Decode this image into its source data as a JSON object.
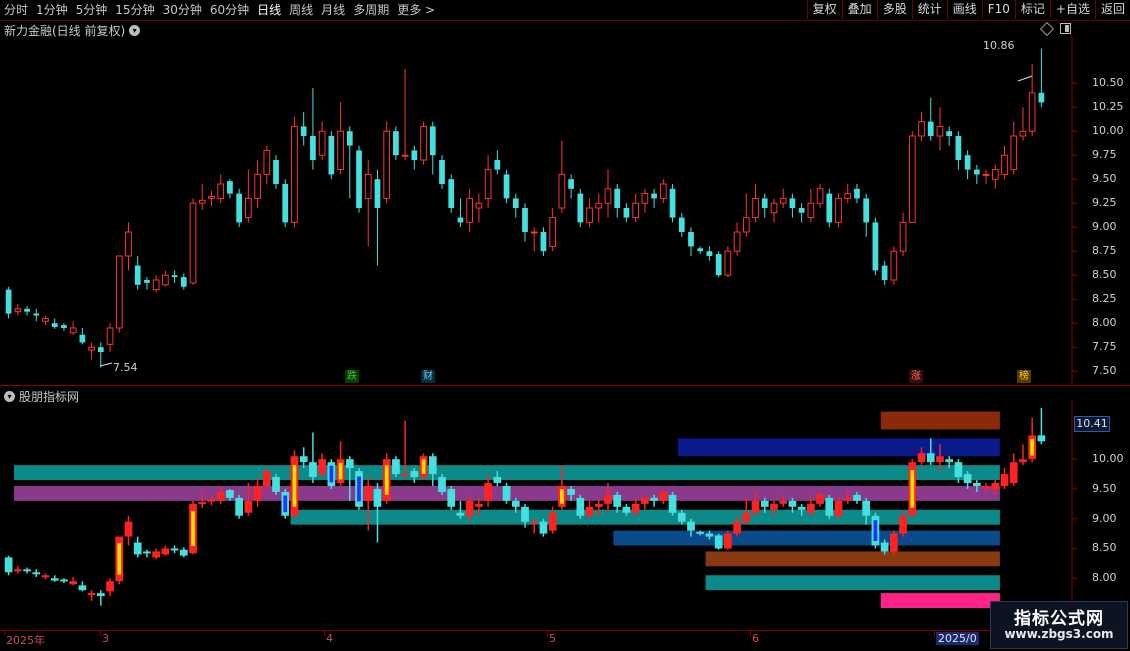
{
  "toolbar": {
    "periods": [
      "分时",
      "1分钟",
      "5分钟",
      "15分钟",
      "30分钟",
      "60分钟",
      "日线",
      "周线",
      "月线",
      "多周期",
      "更多 >"
    ],
    "active_period": "日线",
    "right_buttons": [
      "复权",
      "叠加",
      "多股",
      "统计",
      "画线",
      "F10",
      "标记",
      "+自选",
      "返回"
    ]
  },
  "main_panel": {
    "title": "新力金融(日线 前复权)",
    "high_mark": "10.86",
    "low_mark": "7.54",
    "y_ticks": [
      "10.50",
      "10.25",
      "10.00",
      "9.75",
      "9.50",
      "9.25",
      "9.00",
      "8.75",
      "8.50",
      "8.25",
      "8.00",
      "7.75",
      "7.50"
    ],
    "tags": [
      {
        "text": "跌",
        "color": "#33cc33",
        "bg": "#0a3a0a"
      },
      {
        "text": "财",
        "color": "#66ccff",
        "bg": "#0a2a3a"
      },
      {
        "text": "涨",
        "color": "#ff6666",
        "bg": "#3a0a0a"
      },
      {
        "text": "榜",
        "color": "#ffcc00",
        "bg": "#5a3a00"
      }
    ]
  },
  "indicator_panel": {
    "title": "股朋指标网",
    "y_ticks": [
      "10.00",
      "9.50",
      "9.00",
      "8.50",
      "8.00"
    ],
    "last_value": "10.41"
  },
  "date_axis": [
    "2025年",
    "3",
    "4",
    "5",
    "6",
    "2025/0"
  ],
  "watermark": {
    "line1": "指标公式网",
    "line2": "www.zbgs3.com"
  },
  "colors": {
    "up": "#ff3333",
    "down": "#44e0e0",
    "bg": "#000000",
    "grid": "#8a0000"
  },
  "chart_data": {
    "type": "candlestick",
    "y_range": [
      7.5,
      10.86
    ],
    "candles": [
      [
        8.35,
        8.1,
        8.38,
        8.05
      ],
      [
        8.12,
        8.15,
        8.2,
        8.08
      ],
      [
        8.15,
        8.12,
        8.18,
        8.08
      ],
      [
        8.1,
        8.08,
        8.15,
        8.02
      ],
      [
        8.02,
        8.05,
        8.08,
        7.98
      ],
      [
        8.0,
        7.96,
        8.05,
        7.94
      ],
      [
        7.98,
        7.95,
        8.0,
        7.92
      ],
      [
        7.9,
        7.95,
        8.02,
        7.88
      ],
      [
        7.88,
        7.8,
        7.95,
        7.78
      ],
      [
        7.72,
        7.75,
        7.8,
        7.62
      ],
      [
        7.75,
        7.7,
        7.8,
        7.54
      ],
      [
        7.78,
        7.95,
        8.0,
        7.7
      ],
      [
        7.95,
        8.7,
        8.7,
        7.9
      ],
      [
        8.7,
        8.95,
        9.05,
        8.55
      ],
      [
        8.6,
        8.4,
        8.7,
        8.35
      ],
      [
        8.45,
        8.42,
        8.48,
        8.35
      ],
      [
        8.35,
        8.45,
        8.5,
        8.32
      ],
      [
        8.4,
        8.5,
        8.55,
        8.38
      ],
      [
        8.5,
        8.48,
        8.55,
        8.42
      ],
      [
        8.48,
        8.38,
        8.52,
        8.35
      ],
      [
        8.42,
        9.25,
        9.3,
        8.4
      ],
      [
        9.25,
        9.28,
        9.45,
        9.18
      ],
      [
        9.3,
        9.32,
        9.38,
        9.22
      ],
      [
        9.3,
        9.45,
        9.55,
        9.25
      ],
      [
        9.48,
        9.35,
        9.5,
        9.3
      ],
      [
        9.35,
        9.05,
        9.4,
        9.0
      ],
      [
        9.1,
        9.3,
        9.6,
        9.05
      ],
      [
        9.3,
        9.55,
        9.7,
        9.2
      ],
      [
        9.55,
        9.8,
        9.85,
        9.45
      ],
      [
        9.7,
        9.45,
        9.75,
        9.4
      ],
      [
        9.45,
        9.05,
        9.5,
        9.0
      ],
      [
        9.05,
        10.05,
        10.15,
        9.0
      ],
      [
        10.05,
        9.95,
        10.2,
        9.85
      ],
      [
        9.95,
        9.7,
        10.45,
        9.6
      ],
      [
        9.75,
        10.0,
        10.1,
        9.7
      ],
      [
        9.95,
        9.55,
        10.0,
        9.5
      ],
      [
        9.6,
        10.0,
        10.3,
        9.55
      ],
      [
        10.0,
        9.85,
        10.05,
        9.3
      ],
      [
        9.8,
        9.2,
        9.85,
        9.15
      ],
      [
        9.3,
        9.55,
        9.7,
        8.8
      ],
      [
        9.5,
        9.2,
        9.6,
        8.6
      ],
      [
        9.3,
        10.0,
        10.1,
        9.25
      ],
      [
        10.0,
        9.75,
        10.05,
        9.7
      ],
      [
        9.75,
        9.75,
        10.65,
        9.7
      ],
      [
        9.8,
        9.7,
        9.85,
        9.6
      ],
      [
        9.7,
        10.05,
        10.1,
        9.65
      ],
      [
        10.05,
        9.75,
        10.1,
        9.55
      ],
      [
        9.7,
        9.45,
        9.75,
        9.4
      ],
      [
        9.5,
        9.2,
        9.55,
        9.15
      ],
      [
        9.1,
        9.05,
        9.3,
        9.0
      ],
      [
        9.05,
        9.3,
        9.4,
        8.95
      ],
      [
        9.2,
        9.25,
        9.35,
        9.05
      ],
      [
        9.3,
        9.6,
        9.75,
        9.2
      ],
      [
        9.7,
        9.6,
        9.8,
        9.55
      ],
      [
        9.55,
        9.3,
        9.6,
        9.25
      ],
      [
        9.3,
        9.2,
        9.35,
        9.1
      ],
      [
        9.2,
        8.95,
        9.25,
        8.85
      ],
      [
        8.95,
        8.95,
        9.0,
        8.75
      ],
      [
        8.95,
        8.75,
        9.0,
        8.7
      ],
      [
        8.8,
        9.1,
        9.2,
        8.75
      ],
      [
        9.2,
        9.55,
        9.9,
        9.15
      ],
      [
        9.5,
        9.4,
        9.55,
        9.3
      ],
      [
        9.35,
        9.05,
        9.4,
        9.0
      ],
      [
        9.05,
        9.2,
        9.3,
        9.0
      ],
      [
        9.2,
        9.25,
        9.35,
        9.05
      ],
      [
        9.25,
        9.4,
        9.6,
        9.1
      ],
      [
        9.4,
        9.2,
        9.45,
        9.1
      ],
      [
        9.2,
        9.1,
        9.25,
        9.05
      ],
      [
        9.1,
        9.25,
        9.35,
        9.05
      ],
      [
        9.25,
        9.35,
        9.4,
        9.15
      ],
      [
        9.35,
        9.3,
        9.4,
        9.2
      ],
      [
        9.3,
        9.45,
        9.5,
        9.25
      ],
      [
        9.4,
        9.1,
        9.45,
        9.05
      ],
      [
        9.1,
        8.95,
        9.15,
        8.9
      ],
      [
        8.95,
        8.8,
        9.0,
        8.7
      ],
      [
        8.78,
        8.75,
        8.8,
        8.72
      ],
      [
        8.75,
        8.7,
        8.8,
        8.65
      ],
      [
        8.72,
        8.5,
        8.75,
        8.48
      ],
      [
        8.5,
        8.75,
        8.8,
        8.48
      ],
      [
        8.75,
        8.95,
        9.05,
        8.7
      ],
      [
        8.95,
        9.1,
        9.35,
        8.9
      ],
      [
        9.1,
        9.3,
        9.45,
        9.05
      ],
      [
        9.3,
        9.2,
        9.35,
        9.1
      ],
      [
        9.15,
        9.25,
        9.3,
        9.05
      ],
      [
        9.25,
        9.3,
        9.4,
        9.2
      ],
      [
        9.3,
        9.2,
        9.35,
        9.1
      ],
      [
        9.2,
        9.15,
        9.25,
        9.05
      ],
      [
        9.1,
        9.25,
        9.4,
        9.05
      ],
      [
        9.25,
        9.4,
        9.45,
        9.2
      ],
      [
        9.35,
        9.05,
        9.4,
        9.0
      ],
      [
        9.05,
        9.3,
        9.35,
        9.0
      ],
      [
        9.3,
        9.35,
        9.45,
        9.25
      ],
      [
        9.4,
        9.3,
        9.45,
        9.25
      ],
      [
        9.3,
        9.05,
        9.35,
        8.9
      ],
      [
        9.05,
        8.55,
        9.1,
        8.5
      ],
      [
        8.6,
        8.45,
        8.65,
        8.4
      ],
      [
        8.45,
        8.75,
        8.8,
        8.4
      ],
      [
        8.75,
        9.05,
        9.15,
        8.7
      ],
      [
        9.05,
        9.95,
        10.0,
        9.05
      ],
      [
        9.95,
        10.1,
        10.2,
        9.9
      ],
      [
        10.1,
        9.95,
        10.35,
        9.9
      ],
      [
        9.95,
        10.05,
        10.25,
        9.8
      ],
      [
        10.0,
        9.95,
        10.05,
        9.85
      ],
      [
        9.95,
        9.7,
        10.0,
        9.6
      ],
      [
        9.75,
        9.6,
        9.8,
        9.5
      ],
      [
        9.6,
        9.55,
        9.65,
        9.45
      ],
      [
        9.55,
        9.55,
        9.6,
        9.45
      ],
      [
        9.5,
        9.6,
        9.65,
        9.4
      ],
      [
        9.55,
        9.75,
        9.85,
        9.5
      ],
      [
        9.6,
        9.95,
        10.1,
        9.55
      ],
      [
        9.95,
        10.0,
        10.25,
        9.9
      ],
      [
        10.0,
        10.4,
        10.7,
        9.95
      ],
      [
        10.4,
        10.3,
        10.86,
        10.25
      ]
    ],
    "zones": [
      {
        "color": "#0c8a8a",
        "top": 9.9,
        "bottom": 9.65,
        "from": 0,
        "to": 108
      },
      {
        "color": "#8a3a8a",
        "top": 9.55,
        "bottom": 9.3,
        "from": 0,
        "to": 108
      },
      {
        "color": "#0c8a8a",
        "top": 9.15,
        "bottom": 8.9,
        "from": 30,
        "to": 108
      },
      {
        "color": "#0a4a8a",
        "top": 8.8,
        "bottom": 8.55,
        "from": 65,
        "to": 108
      },
      {
        "color": "#0a1a8a",
        "top": 10.35,
        "bottom": 10.05,
        "from": 72,
        "to": 108
      },
      {
        "color": "#8a2a0a",
        "top": 10.8,
        "bottom": 10.5,
        "from": 94,
        "to": 108
      },
      {
        "color": "#8a3a10",
        "top": 8.45,
        "bottom": 8.2,
        "from": 75,
        "to": 108
      },
      {
        "color": "#0c8a8a",
        "top": 8.05,
        "bottom": 7.8,
        "from": 75,
        "to": 108
      },
      {
        "color": "#ff2288",
        "top": 7.75,
        "bottom": 7.5,
        "from": 94,
        "to": 108
      }
    ]
  }
}
